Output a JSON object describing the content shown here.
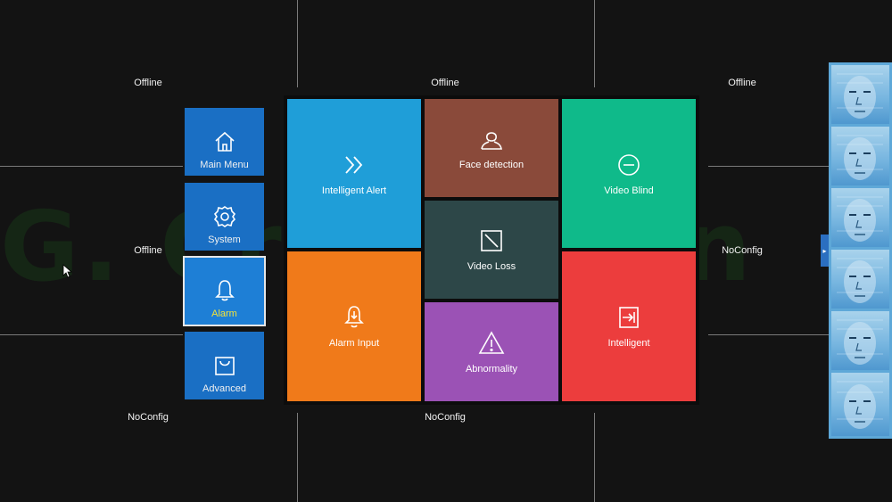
{
  "camera_grid": {
    "labels": [
      "Offline",
      "Offline",
      "Offline",
      "Offline",
      "NoConfig",
      "NoConfig",
      "NoConfig"
    ]
  },
  "watermark": {
    "text": "G. Craftsman"
  },
  "sidebar": {
    "items": [
      {
        "label": "Main Menu",
        "icon": "home-icon",
        "active": false
      },
      {
        "label": "System",
        "icon": "gear-icon",
        "active": false
      },
      {
        "label": "Alarm",
        "icon": "bell-icon",
        "active": true
      },
      {
        "label": "Advanced",
        "icon": "shopping-bag-icon",
        "active": false
      }
    ]
  },
  "alarm_menu": {
    "tiles": [
      {
        "label": "Intelligent Alert",
        "icon": "double-chevron-right-icon",
        "color": "#1f9ed8"
      },
      {
        "label": "Face detection",
        "icon": "face-user-icon",
        "color": "#8a4a3a"
      },
      {
        "label": "Video Blind",
        "icon": "minus-circle-icon",
        "color": "#0fba8a"
      },
      {
        "label": "Video Loss",
        "icon": "slashed-square-icon",
        "color": "#2d4748"
      },
      {
        "label": "Alarm Input",
        "icon": "bell-arrow-icon",
        "color": "#f07a1a"
      },
      {
        "label": "Abnormality",
        "icon": "warning-triangle-icon",
        "color": "#9b52b5"
      },
      {
        "label": "Intelligent",
        "icon": "enter-box-icon",
        "color": "#ec3d3d"
      }
    ]
  },
  "colors": {
    "background": "#131313",
    "sidebar_button": "#1a6fc4",
    "active_label": "#f3e23a"
  }
}
